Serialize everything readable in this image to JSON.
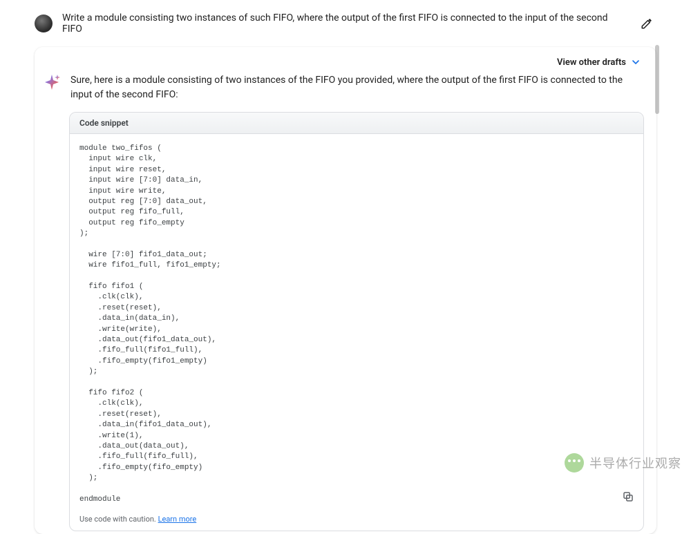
{
  "user": {
    "prompt": "Write a module consisting two instances of such FIFO, where the output of the first FIFO is connected to the input of the second FIFO"
  },
  "drafts": {
    "label": "View other drafts"
  },
  "answer": {
    "intro": "Sure, here is a module consisting of two instances of the FIFO you provided, where the output of the first FIFO is connected to the input of the second FIFO:"
  },
  "code": {
    "header": "Code snippet",
    "content": "module two_fifos (\n  input wire clk,\n  input wire reset,\n  input wire [7:0] data_in,\n  input wire write,\n  output reg [7:0] data_out,\n  output reg fifo_full,\n  output reg fifo_empty\n);\n\n  wire [7:0] fifo1_data_out;\n  wire fifo1_full, fifo1_empty;\n\n  fifo fifo1 (\n    .clk(clk),\n    .reset(reset),\n    .data_in(data_in),\n    .write(write),\n    .data_out(fifo1_data_out),\n    .fifo_full(fifo1_full),\n    .fifo_empty(fifo1_empty)\n  );\n\n  fifo fifo2 (\n    .clk(clk),\n    .reset(reset),\n    .data_in(fifo1_data_out),\n    .write(1),\n    .data_out(data_out),\n    .fifo_full(fifo_full),\n    .fifo_empty(fifo_empty)\n  );\n\nendmodule",
    "caution": "Use code with caution.",
    "learn_more": "Learn more"
  },
  "watermark": {
    "text": "半导体行业观察"
  }
}
